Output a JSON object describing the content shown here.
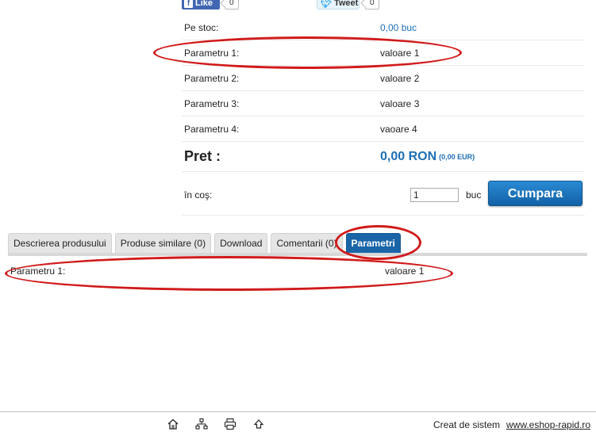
{
  "social": {
    "like_label": "Like",
    "like_count": "0",
    "tweet_label": "Tweet",
    "tweet_count": "0"
  },
  "attributes": [
    {
      "label": "Pe stoc:",
      "value": "0,00 buc"
    },
    {
      "label": "Parametru 1:",
      "value": "valoare 1"
    },
    {
      "label": "Parametru 2:",
      "value": "valoare 2"
    },
    {
      "label": "Parametru 3:",
      "value": "valoare 3"
    },
    {
      "label": "Parametru 4:",
      "value": "vaoare 4"
    }
  ],
  "price": {
    "label": "Pret :",
    "value": "0,00 RON",
    "eur": "(0,00 EUR)"
  },
  "cart": {
    "label": "în coş:",
    "quantity": "1",
    "unit": "buc",
    "buy_label": "Cumpara"
  },
  "tabs": [
    {
      "label": "Descrierea produsului"
    },
    {
      "label": "Produse similare (0)"
    },
    {
      "label": "Download"
    },
    {
      "label": "Comentarii (0)"
    },
    {
      "label": "Parametri"
    }
  ],
  "active_tab": "Parametri",
  "params_panel": [
    {
      "label": "Parametru 1:",
      "value": "valoare 1"
    }
  ],
  "footer": {
    "icons": [
      "home-icon",
      "sitemap-icon",
      "print-icon",
      "scroll-top-icon"
    ],
    "credit": "Creat de sistem",
    "link": "www.eshop-rapid.ro"
  },
  "colors": {
    "accent": "#1a65a8",
    "link_blue": "#1d6fb5",
    "annotation_red": "#d11a1a"
  }
}
